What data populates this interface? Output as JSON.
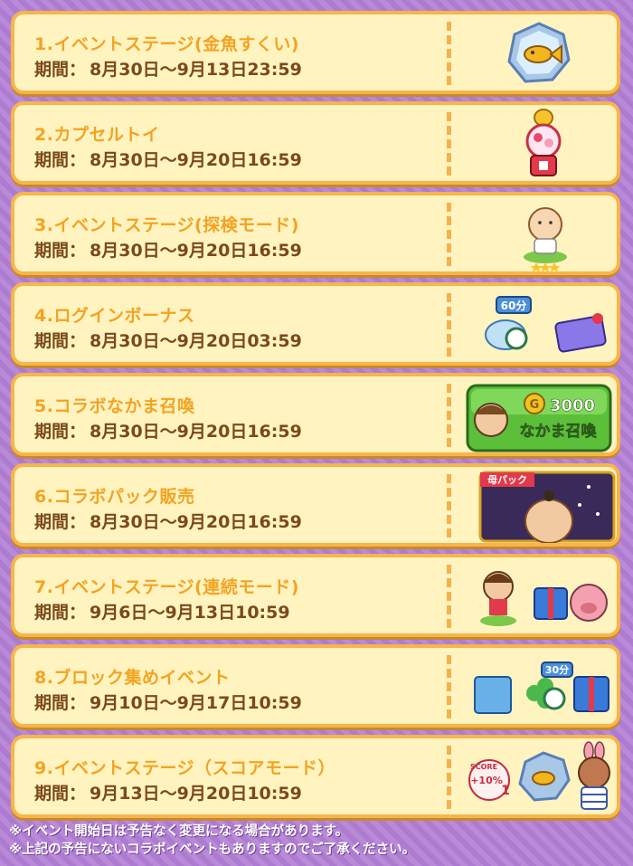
{
  "events": [
    {
      "title": "1.イベントステージ(金魚すくい)",
      "period_label": "期間：",
      "period": "8月30日〜9月13日23:59",
      "icon": "goldfish-badge-icon"
    },
    {
      "title": "2.カプセルトイ",
      "period_label": "期間：",
      "period": "8月30日〜9月20日16:59",
      "icon": "capsule-toy-machine-icon"
    },
    {
      "title": "3.イベントステージ(探検モード)",
      "period_label": "期間：",
      "period": "8月30日〜9月20日16:59",
      "icon": "character-stars-icon"
    },
    {
      "title": "4.ログインボーナス",
      "period_label": "期間：",
      "period": "8月30日〜9月20日03:59",
      "icon": "clock-items-icon",
      "badge": "60分"
    },
    {
      "title": "5.コラボなかま召喚",
      "period_label": "期間：",
      "period": "8月30日〜9月20日16:59",
      "icon": "summon-button-icon",
      "summon": {
        "coins": "3000",
        "label": "なかま召喚"
      }
    },
    {
      "title": "6.コラボパック販売",
      "period_label": "期間：",
      "period": "8月30日〜9月20日16:59",
      "icon": "collab-pack-icon",
      "banner": "母パック"
    },
    {
      "title": "7.イベントステージ(連続モード)",
      "period_label": "期間：",
      "period": "9月6日〜9月13日10:59",
      "icon": "characters-gift-icon"
    },
    {
      "title": "8.ブロック集めイベント",
      "period_label": "期間：",
      "period": "9月10日〜9月17日10:59",
      "icon": "block-clover-gift-icon",
      "badge": "30分"
    },
    {
      "title": "9.イベントステージ（スコアモード）",
      "period_label": "期間：",
      "period": "9月13日〜9月20日10:59",
      "icon": "score-badge-character-icon",
      "score": {
        "top": "SCORE",
        "value": "+10%",
        "level": "1"
      }
    }
  ],
  "notes": [
    "※イベント開始日は予告なく変更になる場合があります。",
    "※上記の予告にないコラボイベントもありますのでご了承ください。"
  ],
  "colors": {
    "card_bg": "#fff3c0",
    "card_border": "#f7b54a",
    "title": "#f3a321",
    "period": "#7a4a1a",
    "background": "#b98ad8"
  }
}
